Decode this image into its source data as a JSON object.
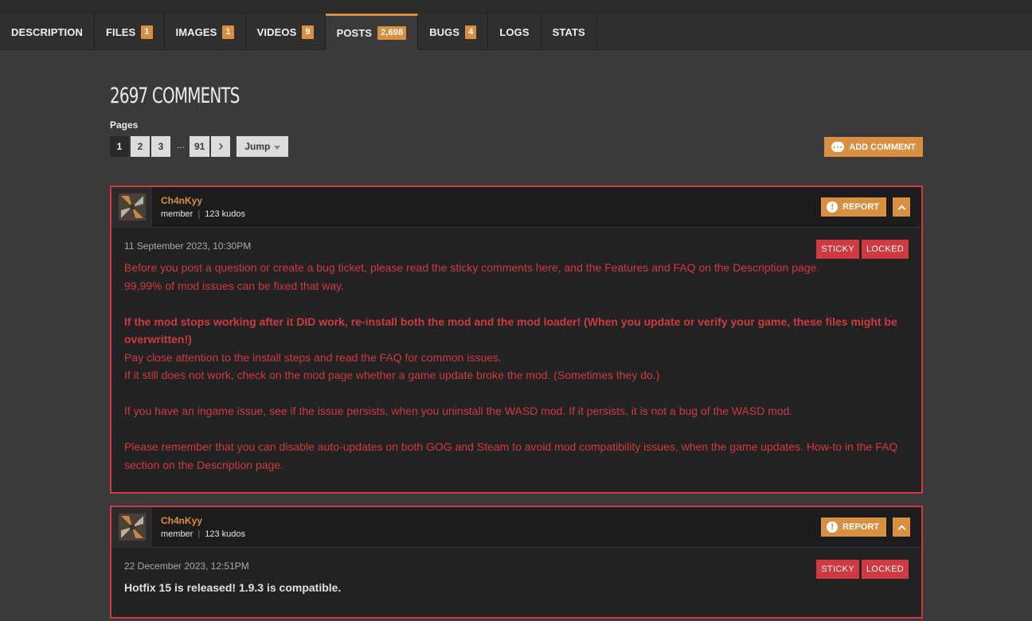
{
  "tabs": [
    {
      "label": "DESCRIPTION",
      "count": ""
    },
    {
      "label": "FILES",
      "count": "1"
    },
    {
      "label": "IMAGES",
      "count": "1"
    },
    {
      "label": "VIDEOS",
      "count": "9"
    },
    {
      "label": "POSTS",
      "count": "2,698"
    },
    {
      "label": "BUGS",
      "count": "4"
    },
    {
      "label": "LOGS",
      "count": ""
    },
    {
      "label": "STATS",
      "count": ""
    }
  ],
  "active_tab": "POSTS",
  "comments": {
    "title": "2697 COMMENTS",
    "pages_label": "Pages",
    "pages": [
      "1",
      "2",
      "3",
      "91"
    ],
    "ellipsis": "...",
    "next_glyph": "›",
    "jump_label": "Jump",
    "add_comment_label": "ADD COMMENT"
  },
  "posts": [
    {
      "author": "Ch4nKyy",
      "role": "member",
      "kudos": "123 kudos",
      "report_label": "REPORT",
      "date": "11 September 2023, 10:30PM",
      "tags": [
        "STICKY",
        "LOCKED"
      ],
      "lines": [
        {
          "text": "Before you post a question or create a bug ticket, please read the sticky comments here, and the Features and FAQ on the Description page.",
          "bold": false
        },
        {
          "text": "99,99% of mod issues can be fixed that way.",
          "bold": false
        },
        {
          "text": "",
          "bold": false
        },
        {
          "text": "If the mod stops working after it DID work, re-install both the mod and the mod loader! (When you update or verify your game, these files might be overwritten!)",
          "bold": true
        },
        {
          "text": "Pay close attention to the install steps and read the FAQ for common issues.",
          "bold": false
        },
        {
          "text": "If it still does not work, check on the mod page whether a game update broke the mod. (Sometimes they do.)",
          "bold": false
        },
        {
          "text": "",
          "bold": false
        },
        {
          "text": "If you have an ingame issue, see if the issue persists, when you uninstall the WASD mod. If it persists, it is not a bug of the WASD mod.",
          "bold": false
        },
        {
          "text": "",
          "bold": false
        },
        {
          "text": "Please remember that you can disable auto-updates on both GOG and Steam to avoid mod compatibility issues, when the game updates. How-to in the FAQ section on the Description page.",
          "bold": false
        }
      ]
    },
    {
      "author": "Ch4nKyy",
      "role": "member",
      "kudos": "123 kudos",
      "report_label": "REPORT",
      "date": "22 December 2023, 12:51PM",
      "tags": [
        "STICKY",
        "LOCKED"
      ],
      "text": "Hotfix 15 is released! 1.9.3 is compatible."
    }
  ],
  "colors": {
    "accent": "#d98f40",
    "alert": "#d0393f",
    "background": "#3a3a3a"
  }
}
